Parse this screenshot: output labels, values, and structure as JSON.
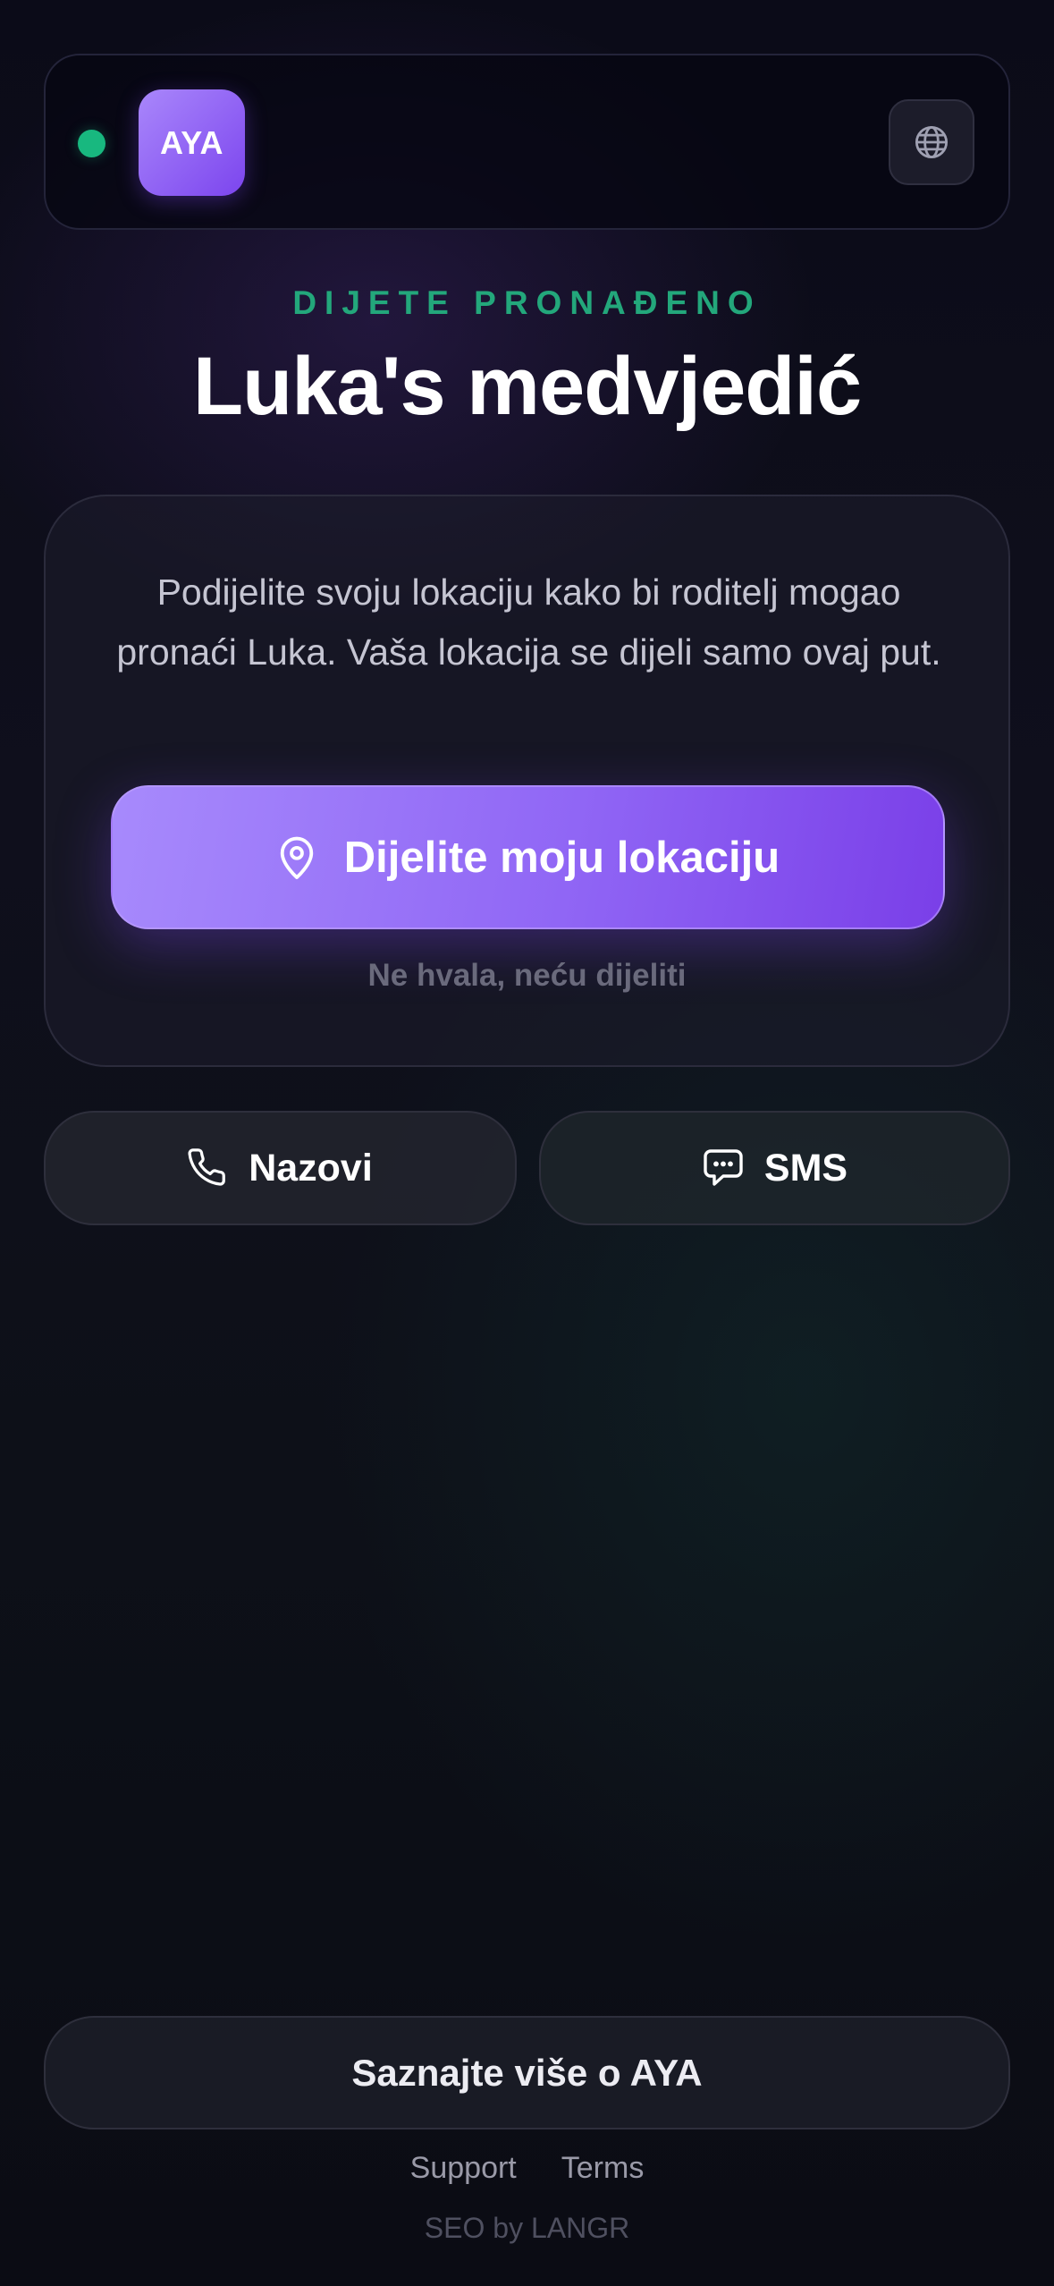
{
  "header": {
    "logo_text": "AYA",
    "status_color": "#18b87f",
    "language_icon": "globe-icon"
  },
  "hero": {
    "eyebrow": "DIJETE PRONAĐENO",
    "title": "Luka's medvjedić"
  },
  "card": {
    "description": "Podijelite svoju lokaciju kako bi roditelj mogao pronaći Luka. Vaša lokacija se dijeli samo ovaj put.",
    "share_button": "Dijelite moju lokaciju",
    "share_icon": "location-pin-icon",
    "decline_link": "Ne hvala, neću dijeliti"
  },
  "actions": {
    "call_label": "Nazovi",
    "call_icon": "phone-icon",
    "sms_label": "SMS",
    "sms_icon": "chat-bubble-icon"
  },
  "footer": {
    "learn_more": "Saznajte više o AYA",
    "support": "Support",
    "terms": "Terms",
    "credit": "SEO by LANGR"
  },
  "colors": {
    "accent": "#7c45ee",
    "accent_light": "#a987fb",
    "success": "#23a77b",
    "background": "#0b0b18"
  }
}
